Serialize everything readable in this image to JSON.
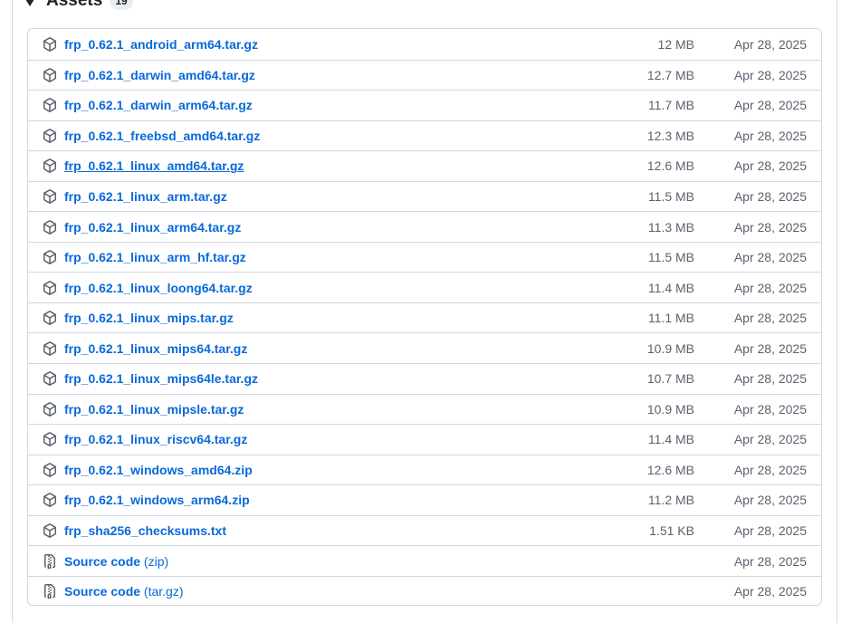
{
  "assets": {
    "title": "Assets",
    "count": "19",
    "items": [
      {
        "name": "frp_0.62.1_android_arm64.tar.gz",
        "suffix": "",
        "size": "12 MB",
        "date": "Apr 28, 2025",
        "icon": "package-icon",
        "hovered": false
      },
      {
        "name": "frp_0.62.1_darwin_amd64.tar.gz",
        "suffix": "",
        "size": "12.7 MB",
        "date": "Apr 28, 2025",
        "icon": "package-icon",
        "hovered": false
      },
      {
        "name": "frp_0.62.1_darwin_arm64.tar.gz",
        "suffix": "",
        "size": "11.7 MB",
        "date": "Apr 28, 2025",
        "icon": "package-icon",
        "hovered": false
      },
      {
        "name": "frp_0.62.1_freebsd_amd64.tar.gz",
        "suffix": "",
        "size": "12.3 MB",
        "date": "Apr 28, 2025",
        "icon": "package-icon",
        "hovered": false
      },
      {
        "name": "frp_0.62.1_linux_amd64.tar.gz",
        "suffix": "",
        "size": "12.6 MB",
        "date": "Apr 28, 2025",
        "icon": "package-icon",
        "hovered": true
      },
      {
        "name": "frp_0.62.1_linux_arm.tar.gz",
        "suffix": "",
        "size": "11.5 MB",
        "date": "Apr 28, 2025",
        "icon": "package-icon",
        "hovered": false
      },
      {
        "name": "frp_0.62.1_linux_arm64.tar.gz",
        "suffix": "",
        "size": "11.3 MB",
        "date": "Apr 28, 2025",
        "icon": "package-icon",
        "hovered": false
      },
      {
        "name": "frp_0.62.1_linux_arm_hf.tar.gz",
        "suffix": "",
        "size": "11.5 MB",
        "date": "Apr 28, 2025",
        "icon": "package-icon",
        "hovered": false
      },
      {
        "name": "frp_0.62.1_linux_loong64.tar.gz",
        "suffix": "",
        "size": "11.4 MB",
        "date": "Apr 28, 2025",
        "icon": "package-icon",
        "hovered": false
      },
      {
        "name": "frp_0.62.1_linux_mips.tar.gz",
        "suffix": "",
        "size": "11.1 MB",
        "date": "Apr 28, 2025",
        "icon": "package-icon",
        "hovered": false
      },
      {
        "name": "frp_0.62.1_linux_mips64.tar.gz",
        "suffix": "",
        "size": "10.9 MB",
        "date": "Apr 28, 2025",
        "icon": "package-icon",
        "hovered": false
      },
      {
        "name": "frp_0.62.1_linux_mips64le.tar.gz",
        "suffix": "",
        "size": "10.7 MB",
        "date": "Apr 28, 2025",
        "icon": "package-icon",
        "hovered": false
      },
      {
        "name": "frp_0.62.1_linux_mipsle.tar.gz",
        "suffix": "",
        "size": "10.9 MB",
        "date": "Apr 28, 2025",
        "icon": "package-icon",
        "hovered": false
      },
      {
        "name": "frp_0.62.1_linux_riscv64.tar.gz",
        "suffix": "",
        "size": "11.4 MB",
        "date": "Apr 28, 2025",
        "icon": "package-icon",
        "hovered": false
      },
      {
        "name": "frp_0.62.1_windows_amd64.zip",
        "suffix": "",
        "size": "12.6 MB",
        "date": "Apr 28, 2025",
        "icon": "package-icon",
        "hovered": false
      },
      {
        "name": "frp_0.62.1_windows_arm64.zip",
        "suffix": "",
        "size": "11.2 MB",
        "date": "Apr 28, 2025",
        "icon": "package-icon",
        "hovered": false
      },
      {
        "name": "frp_sha256_checksums.txt",
        "suffix": "",
        "size": "1.51 KB",
        "date": "Apr 28, 2025",
        "icon": "package-icon",
        "hovered": false
      },
      {
        "name": "Source code",
        "suffix": " (zip)",
        "size": "",
        "date": "Apr 28, 2025",
        "icon": "file-zip-icon",
        "hovered": false
      },
      {
        "name": "Source code",
        "suffix": " (tar.gz)",
        "size": "",
        "date": "Apr 28, 2025",
        "icon": "file-zip-icon",
        "hovered": false
      }
    ]
  },
  "colors": {
    "link": "#0969da",
    "muted": "#59636e",
    "border": "#d1d9e0"
  }
}
